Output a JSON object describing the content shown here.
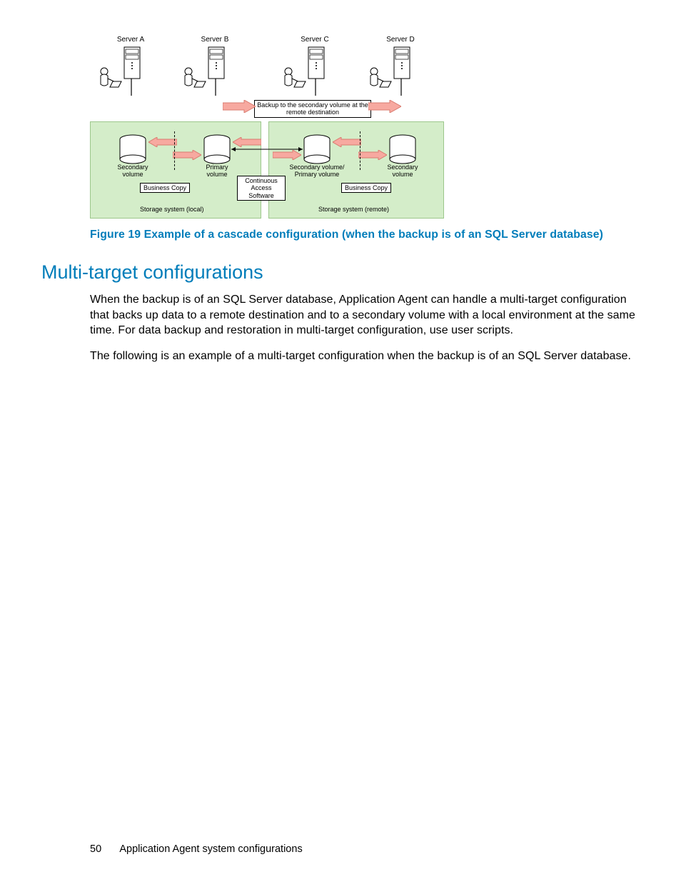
{
  "diagram": {
    "servers": [
      "Server A",
      "Server B",
      "Server C",
      "Server D"
    ],
    "backup_note": "Backup to the secondary volume at the remote destination",
    "volumes": {
      "secondary": "Secondary volume",
      "primary": "Primary volume",
      "sec_primary": "Secondary volume/ Primary volume",
      "secondary2": "Secondary volume"
    },
    "business_copy": "Business Copy",
    "continuous_access": "Continuous Access Software",
    "storage_local": "Storage system (local)",
    "storage_remote": "Storage system (remote)"
  },
  "caption": "Figure 19 Example of a cascade configuration (when the backup is of an SQL Server database)",
  "heading": "Multi-target configurations",
  "para1": "When the backup is of an SQL Server database, Application Agent can handle a multi-target configuration that backs up data to a remote destination and to a secondary volume with a local environment at the same time. For data backup and restoration in multi-target configuration, use user scripts.",
  "para2": "The following is an example of a multi-target configuration when the backup is of an SQL Server database.",
  "footer": {
    "page": "50",
    "title": "Application Agent system configurations"
  }
}
